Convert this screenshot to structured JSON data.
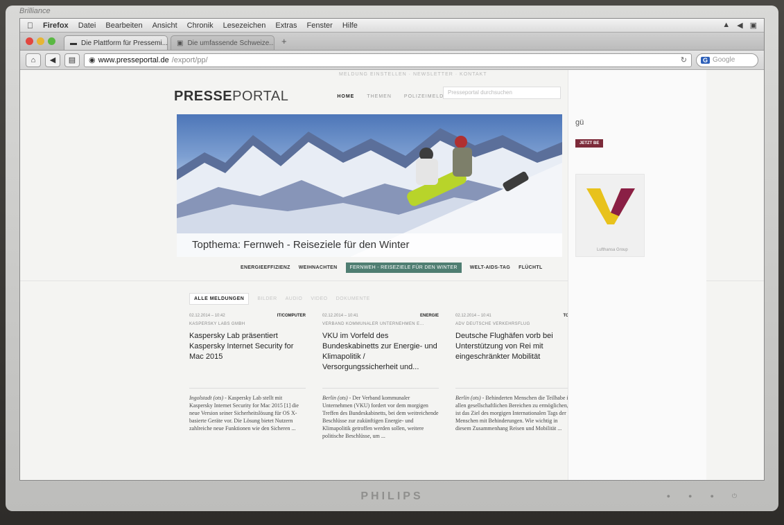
{
  "monitor": {
    "brand": "Brilliance",
    "maker": "PHILIPS"
  },
  "menubar": {
    "app": "Firefox",
    "items": [
      "Datei",
      "Bearbeiten",
      "Ansicht",
      "Chronik",
      "Lesezeichen",
      "Extras",
      "Fenster",
      "Hilfe"
    ]
  },
  "tabs": [
    {
      "title": "Die Plattform für Pressemi..."
    },
    {
      "title": "Die umfassende Schweize..."
    }
  ],
  "navbar": {
    "url_host": "www.presseportal.de",
    "url_path": "/export/pp/",
    "search_engine": "G",
    "search_placeholder": "Google"
  },
  "page": {
    "utility_links": "MELDUNG EINSTELLEN · NEWSLETTER · KONTAKT",
    "logo_bold": "PRESSE",
    "logo_rest": "PORTAL",
    "nav": [
      "HOME",
      "THEMEN",
      "POLIZEIMELDUNGEN"
    ],
    "search_placeholder": "Presseportal durchsuchen",
    "hero_caption": "Topthema: Fernweh - Reiseziele für den Winter",
    "topics": [
      "ENERGIEEFFIZIENZ",
      "WEIHNACHTEN",
      "FERNWEH - REISEZIELE FÜR DEN WINTER",
      "WELT-AIDS-TAG",
      "FLÜCHTL"
    ],
    "filters": [
      "ALLE MELDUNGEN",
      "BILDER",
      "AUDIO",
      "VIDEO",
      "DOKUMENTE"
    ],
    "cards": [
      {
        "date": "02.12.2014 – 10:42",
        "category": "IT/COMPUTER",
        "source": "KASPERSKY LABS GMBH",
        "title": "Kaspersky Lab präsentiert Kaspersky Internet Security for Mac 2015",
        "teaser_place": "Ingolstadt (ots)",
        "teaser": " - Kaspersky Lab stellt mit Kaspersky Internet Security for Mac 2015 [1] die neue Version seiner Sicherheitslösung für OS X-basierte Geräte vor. Die Lösung bietet Nutzern zahlreiche neue Funktionen wie den Sicheren ..."
      },
      {
        "date": "02.12.2014 – 10:41",
        "category": "ENERGIE",
        "source": "VERBAND KOMMUNALER UNTERNEHMEN E...",
        "title": "VKU im Vorfeld des Bundeskabinetts zur Energie- und Klimapolitik / Versorgungssicherheit und...",
        "teaser_place": "Berlin (ots)",
        "teaser": " - Der Verband kommunaler Unternehmen (VKU) fordert vor dem morgigen Treffen des Bundeskabinetts, bei dem weitreichende Beschlüsse zur zukünftigen Energie- und Klimapolitik getroffen werden sollen, weitere politische Beschlüsse, um ..."
      },
      {
        "date": "02.12.2014 – 10:41",
        "category": "TOU",
        "source": "ADV DEUTSCHE VERKEHRSFLUG",
        "title": "Deutsche Flughäfen vorb bei Unterstützung von Rei mit eingeschränkter Mobilität",
        "teaser_place": "Berlin (ots)",
        "teaser": " - Behinderten Menschen die Teilhabe in allen gesellschaftlichen Bereichen zu ermöglichen, ist das Ziel des morgigen Internationalen Tags der Menschen mit Behinderungen. Wie wichtig in diesem Zusammenhang Reisen und Mobilität ..."
      }
    ],
    "sidebar": {
      "heading": "gü",
      "button": "JETZT BE",
      "ad_label": "Lufthansa Group"
    }
  },
  "colors": {
    "accent_green": "#4f7e72",
    "sidebar_button": "#7c2a39"
  }
}
